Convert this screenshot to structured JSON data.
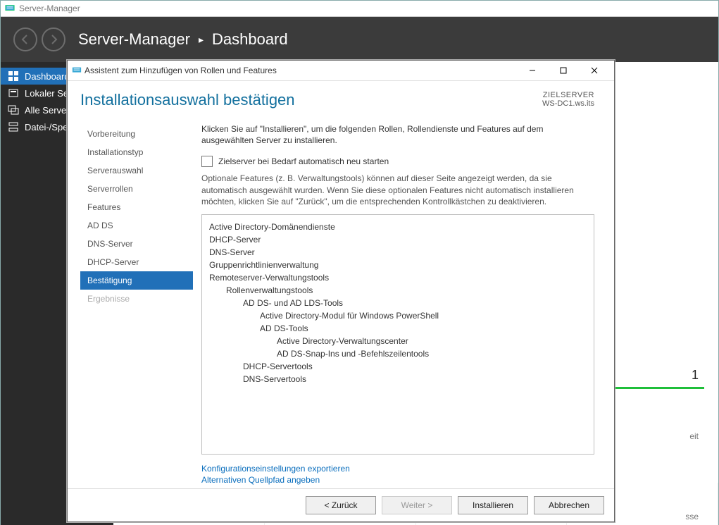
{
  "main": {
    "title": "Server-Manager",
    "breadcrumb_app": "Server-Manager",
    "breadcrumb_page": "Dashboard"
  },
  "sidebar": {
    "items": [
      {
        "label": "Dashboard"
      },
      {
        "label": "Lokaler Server"
      },
      {
        "label": "Alle Server"
      },
      {
        "label": "Datei-/Speicherdienste"
      }
    ]
  },
  "bg": {
    "count": "1",
    "hint1": "eit",
    "hint2": "sse"
  },
  "dialog": {
    "title": "Assistent zum Hinzufügen von Rollen und Features",
    "heading": "Installationsauswahl bestätigen",
    "target_label": "ZIELSERVER",
    "target_value": "WS-DC1.ws.its",
    "steps": [
      {
        "label": "Vorbereitung"
      },
      {
        "label": "Installationstyp"
      },
      {
        "label": "Serverauswahl"
      },
      {
        "label": "Serverrollen"
      },
      {
        "label": "Features"
      },
      {
        "label": "AD DS"
      },
      {
        "label": "DNS-Server"
      },
      {
        "label": "DHCP-Server"
      },
      {
        "label": "Bestätigung"
      },
      {
        "label": "Ergebnisse"
      }
    ],
    "intro": "Klicken Sie auf \"Installieren\", um die folgenden Rollen, Rollendienste und Features auf dem ausgewählten Server zu installieren.",
    "checkbox_label": "Zielserver bei Bedarf automatisch neu starten",
    "note": "Optionale Features (z. B. Verwaltungstools) können auf dieser Seite angezeigt werden, da sie automatisch ausgewählt wurden. Wenn Sie diese optionalen Features nicht automatisch installieren möchten, klicken Sie auf \"Zurück\", um die entsprechenden Kontrollkästchen zu deaktivieren.",
    "features": [
      {
        "label": "Active Directory-Domänendienste",
        "indent": 0
      },
      {
        "label": "DHCP-Server",
        "indent": 0
      },
      {
        "label": "DNS-Server",
        "indent": 0
      },
      {
        "label": "Gruppenrichtlinienverwaltung",
        "indent": 0
      },
      {
        "label": "Remoteserver-Verwaltungstools",
        "indent": 0
      },
      {
        "label": "Rollenverwaltungstools",
        "indent": 1
      },
      {
        "label": "AD DS- und AD LDS-Tools",
        "indent": 2
      },
      {
        "label": "Active Directory-Modul für Windows PowerShell",
        "indent": 3
      },
      {
        "label": "AD DS-Tools",
        "indent": 3
      },
      {
        "label": "Active Directory-Verwaltungscenter",
        "indent": 3,
        "extra": 1
      },
      {
        "label": "AD DS-Snap-Ins und -Befehlszeilentools",
        "indent": 3,
        "extra": 1
      },
      {
        "label": "DHCP-Servertools",
        "indent": 2
      },
      {
        "label": "DNS-Servertools",
        "indent": 2
      }
    ],
    "links": {
      "export": "Konfigurationseinstellungen exportieren",
      "altpath": "Alternativen Quellpfad angeben"
    },
    "buttons": {
      "back": "< Zurück",
      "next": "Weiter >",
      "install": "Installieren",
      "cancel": "Abbrechen"
    }
  }
}
